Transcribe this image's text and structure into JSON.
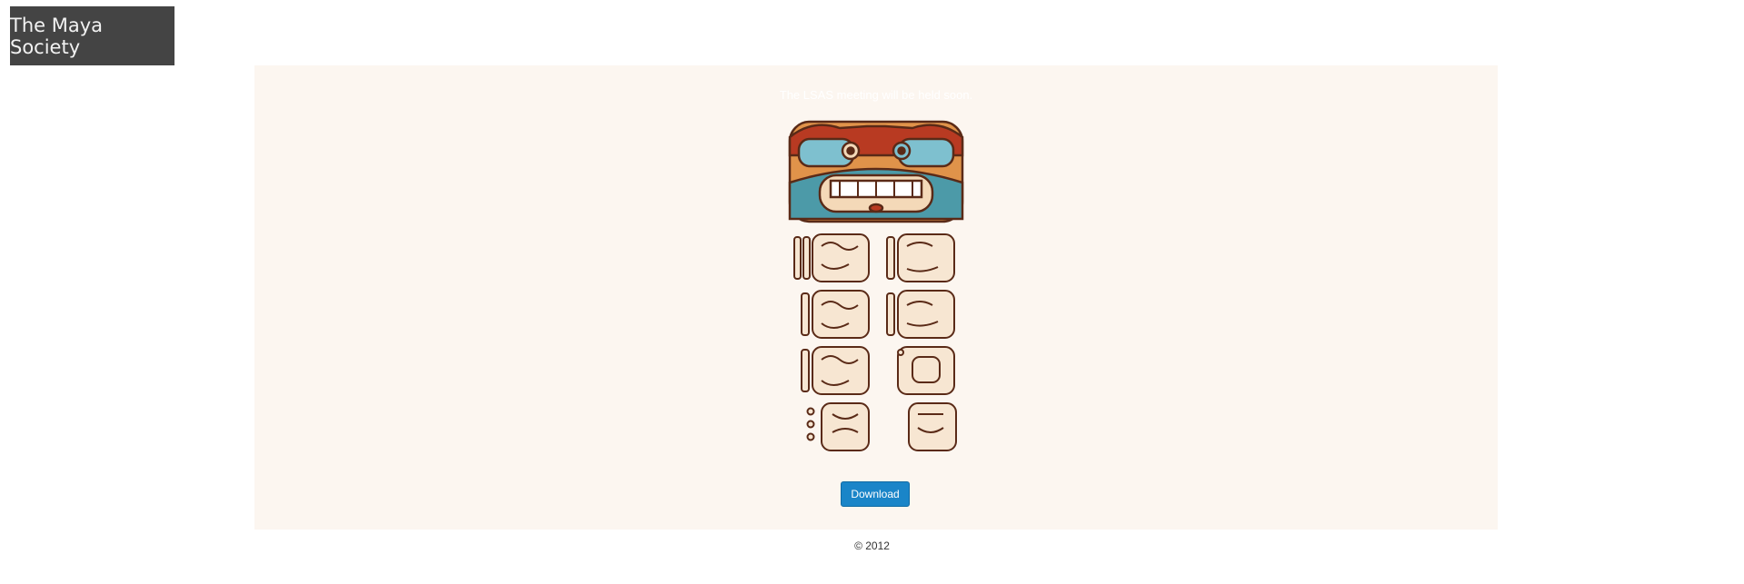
{
  "header": {
    "brand": "The Maya Society"
  },
  "main": {
    "notice": "The LSAS meeting will be held soon.",
    "download_label": "Download"
  },
  "footer": {
    "copyright": "© 2012"
  },
  "colors": {
    "brand_bg": "#444444",
    "panel_bg": "#fcf6f0",
    "button_bg": "#1a85c8"
  }
}
